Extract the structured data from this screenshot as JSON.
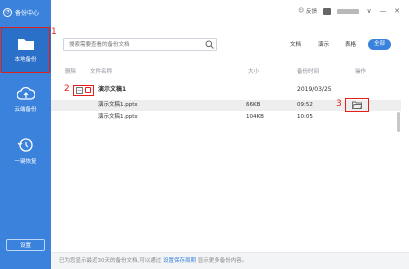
{
  "app": {
    "title": "备份中心"
  },
  "sidebar": {
    "items": [
      {
        "label": "本地备份"
      },
      {
        "label": "云端备份"
      },
      {
        "label": "一键恢复"
      }
    ],
    "settings_label": "设置"
  },
  "topbar": {
    "feedback_label": "反馈",
    "window_controls": [
      "∨",
      "—",
      "✕"
    ]
  },
  "search": {
    "placeholder": "搜索需要查看的备份文档"
  },
  "filters": [
    "文档",
    "演示",
    "表格",
    "全部"
  ],
  "columns": {
    "delete": "删除",
    "name": "文件名称",
    "size": "大小",
    "time": "备份时间",
    "action": "操作"
  },
  "group": {
    "name": "演示文稿1",
    "date": "2019/03/25"
  },
  "rows": [
    {
      "name": "演示文稿1.pptx",
      "size": "66KB",
      "time": "09:52"
    },
    {
      "name": "演示文稿1.pptx",
      "size": "104KB",
      "time": "10:05"
    }
  ],
  "annotations": [
    "1",
    "2",
    "3"
  ],
  "footer": {
    "prefix": "已为您显示最近30天的备份文档,可以通过",
    "link": "设置保存周期",
    "suffix": "显示更多备份内容。"
  },
  "colors": {
    "accent": "#3a82dc",
    "marker": "#e0201c"
  }
}
